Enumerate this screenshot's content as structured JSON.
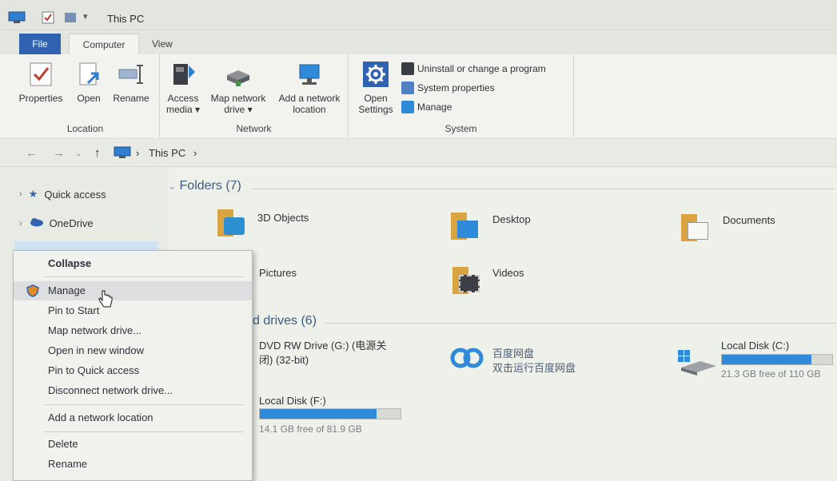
{
  "window": {
    "title": "This PC"
  },
  "ribbon_tabs": [
    {
      "label": "File"
    },
    {
      "label": "Computer"
    },
    {
      "label": "View"
    }
  ],
  "ribbon": {
    "location": {
      "label": "Location",
      "buttons": [
        {
          "label": "Properties"
        },
        {
          "label": "Open"
        },
        {
          "label": "Rename"
        }
      ]
    },
    "network": {
      "label": "Network",
      "buttons": [
        {
          "line1": "Access",
          "line2": "media ▾"
        },
        {
          "line1": "Map network",
          "line2": "drive ▾"
        },
        {
          "line1": "Add a network",
          "line2": "location"
        }
      ]
    },
    "system": {
      "label": "System",
      "open_settings": {
        "line1": "Open",
        "line2": "Settings"
      },
      "items": [
        {
          "label": "Uninstall or change a program"
        },
        {
          "label": "System properties"
        },
        {
          "label": "Manage"
        }
      ]
    }
  },
  "address": {
    "path": [
      "This PC"
    ],
    "separator": "›"
  },
  "nav": {
    "items": [
      {
        "label": "Quick access"
      },
      {
        "label": "OneDrive"
      }
    ]
  },
  "content": {
    "folders_header": "Folders (7)",
    "folders": [
      {
        "name": "3D Objects"
      },
      {
        "name": "Desktop"
      },
      {
        "name": "Documents"
      },
      {
        "name": "Pictures"
      },
      {
        "name": "Videos"
      }
    ],
    "drives_header": "d drives (6)",
    "drives": [
      {
        "name_line1": "DVD RW Drive (G:) (电源关",
        "name_line2": "闭) (32-bit)"
      },
      {
        "name": "百度网盘",
        "subtitle": "双击运行百度网盘"
      },
      {
        "name": "Local Disk (C:)",
        "free": "21.3 GB free of 110 GB",
        "used_fraction": 0.81
      },
      {
        "name": "Local Disk (F:)",
        "free": "14.1 GB free of 81.9 GB",
        "used_fraction": 0.83
      }
    ]
  },
  "context_menu": {
    "items": [
      {
        "label": "Collapse"
      },
      {
        "label": "Manage"
      },
      {
        "label": "Pin to Start"
      },
      {
        "label": "Map network drive..."
      },
      {
        "label": "Open in new window"
      },
      {
        "label": "Pin to Quick access"
      },
      {
        "label": "Disconnect network drive..."
      },
      {
        "label": "Add a network location"
      },
      {
        "label": "Delete"
      },
      {
        "label": "Rename"
      }
    ]
  },
  "colors": {
    "file_tab": "#2f63b2",
    "accent_blue": "#2f8ad9",
    "folder_yellow": "#d9a441"
  }
}
